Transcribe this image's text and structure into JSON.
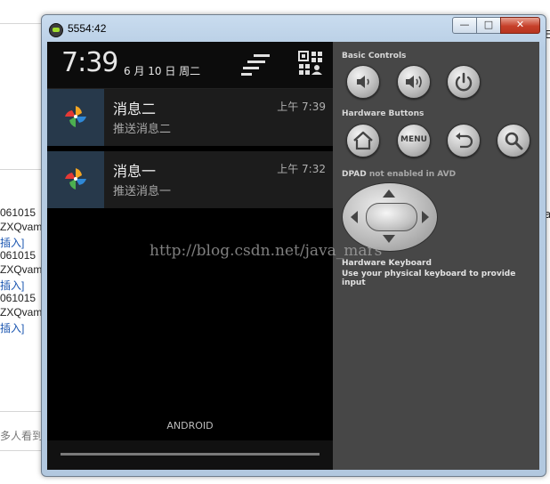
{
  "background_page": {
    "lines": [
      {
        "text": "061015",
        "type": "plain"
      },
      {
        "text": "ZXQvam",
        "type": "plain"
      },
      {
        "text": "插入]",
        "type": "link"
      },
      {
        "text": "061015",
        "type": "plain"
      },
      {
        "text": "ZXQvam",
        "type": "plain"
      },
      {
        "text": "插入]",
        "type": "link"
      },
      {
        "text": "061015",
        "type": "plain"
      },
      {
        "text": "ZXQvam",
        "type": "plain"
      },
      {
        "text": "插入]",
        "type": "link"
      }
    ],
    "footer_text": "多人看到",
    "right_glyph_1": "E",
    "right_glyph_2": "a"
  },
  "window": {
    "title": "5554:42",
    "buttons": {
      "minimize": "—",
      "maximize": "□",
      "close": "✕"
    }
  },
  "device": {
    "clock": "7:39",
    "date": "6 月 10 日 周二",
    "icons": {
      "clear": "clear-all-icon",
      "settings": "quick-settings-icon"
    },
    "notifications": [
      {
        "title": "消息二",
        "body": "推送消息二",
        "time": "上午 7:39",
        "icon": "pinwheel-app-icon"
      },
      {
        "title": "消息一",
        "body": "推送消息一",
        "time": "上午 7:32",
        "icon": "pinwheel-app-icon"
      }
    ],
    "carrier": "ANDROID"
  },
  "controls": {
    "basic_controls_label": "Basic Controls",
    "hardware_buttons_label": "Hardware Buttons",
    "dpad_label": "DPAD",
    "dpad_note": "not enabled in AVD",
    "keyboard_label": "Hardware Keyboard",
    "keyboard_note": "Use your physical keyboard to provide input",
    "menu_text": "MENU",
    "basic_buttons": [
      "volume-down-icon",
      "volume-up-icon",
      "power-icon"
    ],
    "hardware_buttons": [
      "home-icon",
      "menu-button",
      "back-icon",
      "search-icon"
    ]
  },
  "watermark": "http://blog.csdn.net/java_mars"
}
